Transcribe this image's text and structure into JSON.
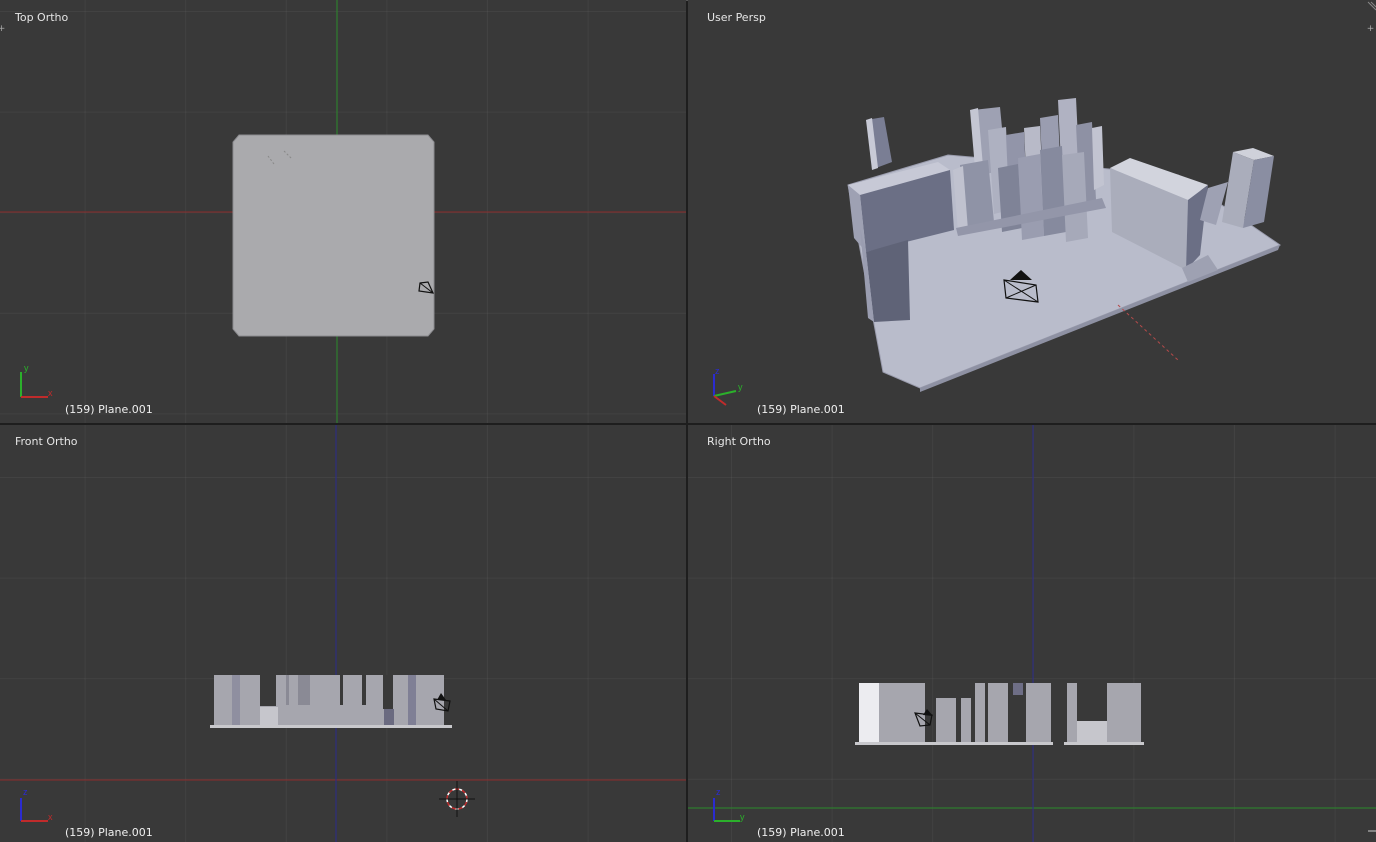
{
  "viewports": {
    "top": {
      "title": "Top Ortho",
      "status": "(159) Plane.001"
    },
    "persp": {
      "title": "User Persp",
      "status": "(159) Plane.001"
    },
    "front": {
      "title": "Front Ortho",
      "status": "(159) Plane.001"
    },
    "right": {
      "title": "Right Ortho",
      "status": "(159) Plane.001"
    }
  },
  "axes": {
    "x": "x",
    "y": "y",
    "z": "z"
  },
  "colors": {
    "viewport_bg": "#393939",
    "axis_x": "#c02b2b",
    "axis_y": "#2bb02b",
    "axis_z": "#2b2bd0",
    "mesh": "#a9a9b0",
    "mesh_side": "#6a6d80"
  },
  "icons": [
    "plus-icon",
    "camera-icon",
    "3d-cursor-icon",
    "axis-gizmo-icon"
  ]
}
